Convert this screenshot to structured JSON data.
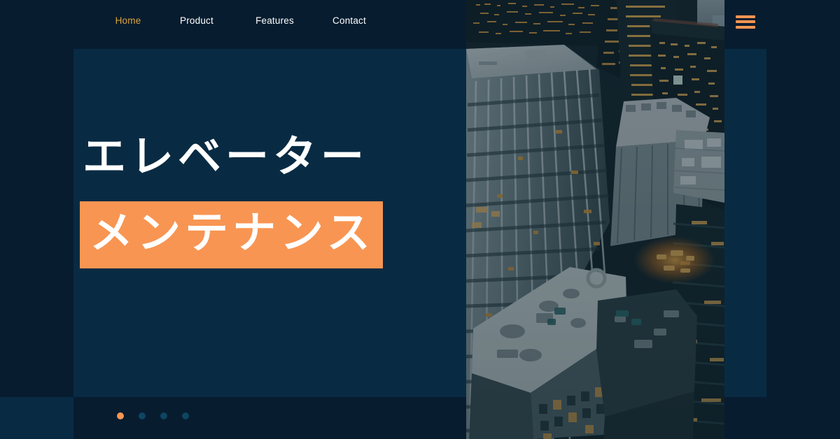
{
  "site": {
    "background_color": "#071c2f",
    "panel_color": "#082b43",
    "accent_color": "#f89552",
    "active_nav_color": "#d9a441"
  },
  "nav": {
    "items": [
      {
        "label": "Home",
        "active": true
      },
      {
        "label": "Product",
        "active": false
      },
      {
        "label": "Features",
        "active": false
      },
      {
        "label": "Contact",
        "active": false
      }
    ],
    "menu_icon": "hamburger-menu-icon"
  },
  "hero": {
    "heading_line1": "エレベーター",
    "heading_line2": "メンテナンス",
    "highlight_color": "#f89552",
    "image": {
      "name": "aerial-cityscape-photo",
      "description": "Aerial view of downtown skyscrapers at dusk with lit windows"
    }
  },
  "carousel": {
    "dots": [
      {
        "index": 1,
        "active": true
      },
      {
        "index": 2,
        "active": false
      },
      {
        "index": 3,
        "active": false
      },
      {
        "index": 4,
        "active": false
      }
    ]
  }
}
